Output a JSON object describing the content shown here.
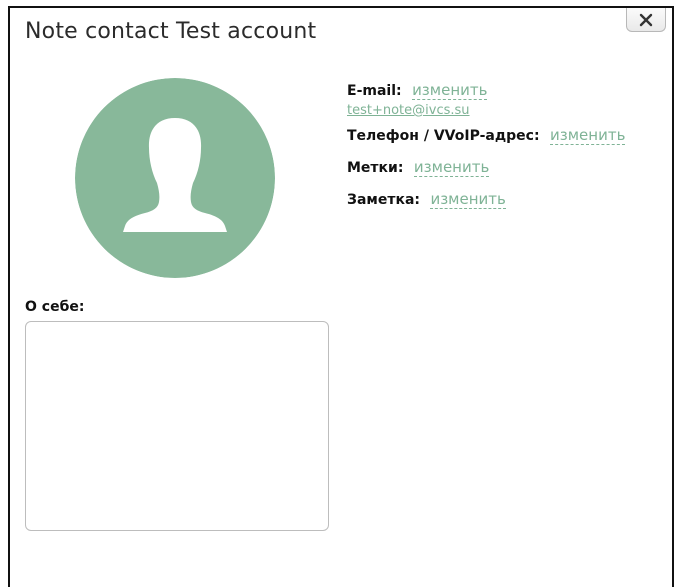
{
  "dialog": {
    "title": "Note contact Test account",
    "close_icon": "close-icon",
    "avatar_icon": "user-silhouette-icon",
    "accent_color": "#7fb396",
    "avatar_color": "#88b89a"
  },
  "fields": {
    "email_label": "E-mail:",
    "email_action": "изменить",
    "email_value": "test+note@ivcs.su",
    "phone_label": "Телефон / VVoIP-адрес:",
    "phone_action": "изменить",
    "tags_label": "Метки:",
    "tags_action": "изменить",
    "note_label": "Заметка:",
    "note_action": "изменить"
  },
  "about": {
    "label": "О себе:",
    "value": ""
  }
}
